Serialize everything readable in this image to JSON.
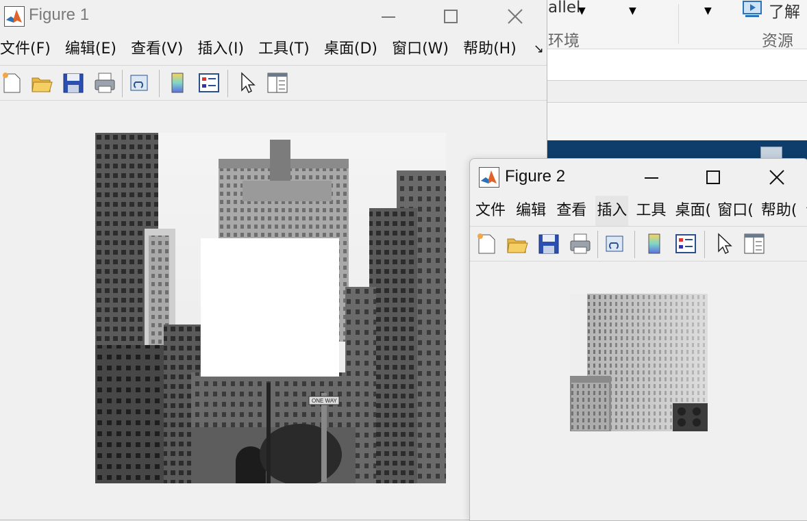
{
  "background_app": {
    "ribbon": {
      "parallel_label": "allel",
      "env_label": "环境",
      "learn_label": "了解",
      "resources_label": "资源"
    }
  },
  "figure1": {
    "title": "Figure 1",
    "menus": [
      "文件(F)",
      "编辑(E)",
      "查看(V)",
      "插入(I)",
      "工具(T)",
      "桌面(D)",
      "窗口(W)",
      "帮助(H)"
    ],
    "overflow_icon": "dock-arrow-icon",
    "toolbar": [
      "new-figure-icon",
      "open-file-icon",
      "save-icon",
      "print-icon",
      "link-plot-icon",
      "colorbar-icon",
      "legend-icon",
      "pointer-icon",
      "property-inspector-icon"
    ],
    "image_desc_text": "",
    "sign_text": "ONE WAY"
  },
  "figure2": {
    "title": "Figure 2",
    "menus": [
      "文件",
      "编辑",
      "查看",
      "插入",
      "工具",
      "桌面(",
      "窗口(",
      "帮助("
    ],
    "overflow_icon": "dock-arrow-icon",
    "toolbar": [
      "new-figure-icon",
      "open-file-icon",
      "save-icon",
      "print-icon",
      "link-plot-icon",
      "colorbar-icon",
      "legend-icon",
      "pointer-icon",
      "property-inspector-icon"
    ]
  },
  "colors": {
    "window_bg": "#f0f0f0",
    "matlab_orange": "#e0642a",
    "matlab_blue": "#2a73b9",
    "ribbon_blue": "#0e3d6b"
  }
}
